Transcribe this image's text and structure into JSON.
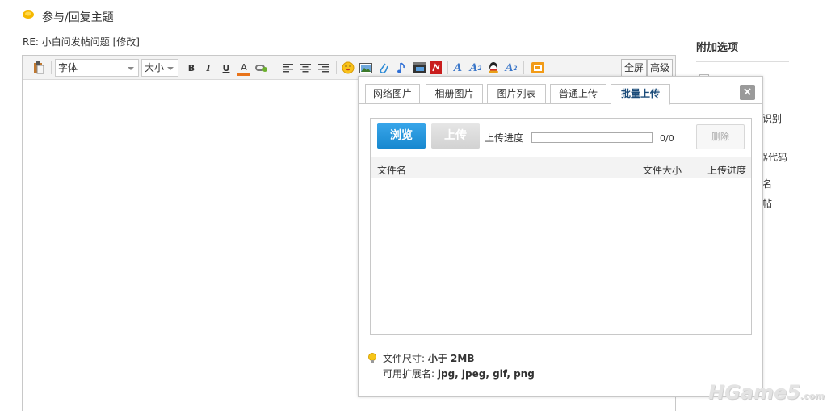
{
  "header": {
    "title": "参与/回复主题",
    "subject": "RE: 小白问发帖问题 [修改]"
  },
  "toolbar": {
    "font_label": "字体",
    "size_label": "大小",
    "bold": "B",
    "italic": "I",
    "underline": "U",
    "fontcolor": "A",
    "fullscreen": "全屏",
    "advanced": "高级"
  },
  "sidebar": {
    "title": "附加选项",
    "items": [
      "识别",
      "器代码",
      "名",
      "帖"
    ]
  },
  "popup": {
    "tabs": [
      "网络图片",
      "相册图片",
      "图片列表",
      "普通上传",
      "批量上传"
    ],
    "active_tab": "批量上传",
    "close": "×",
    "browse": "浏览",
    "upload": "上传",
    "progress_label": "上传进度",
    "progress": 0,
    "count": "0/0",
    "delete": "删除",
    "columns": [
      "文件名",
      "文件大小",
      "上传进度"
    ],
    "info_size_label": "文件尺寸:",
    "info_size_value": "小于 2MB",
    "info_ext_label": "可用扩展名:",
    "info_ext_value": "jpg, jpeg, gif, png"
  },
  "watermark": {
    "main": "HGame5",
    "suffix": ".com"
  },
  "colors": {
    "browse": "#1788cf",
    "active_tab": "#1b4c7a",
    "toolbar": "#f3f3f3"
  }
}
